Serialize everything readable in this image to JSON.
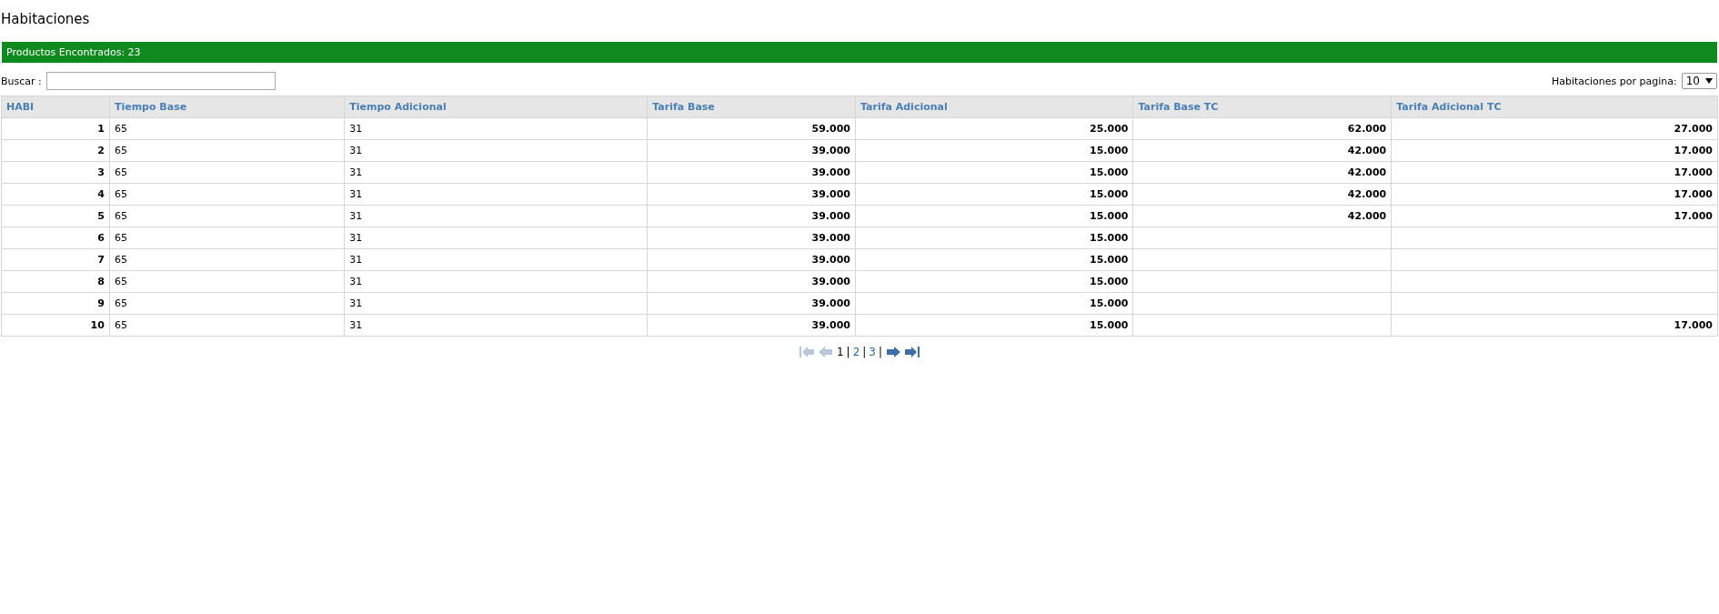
{
  "title": "Habitaciones",
  "banner": "Productos Encontrados: 23",
  "search": {
    "label": "Buscar :"
  },
  "per_page": {
    "label": "Habitaciones por pagina:",
    "value": "10"
  },
  "table": {
    "columns": [
      {
        "label": "HABI",
        "kind": "number"
      },
      {
        "label": "Tiempo Base",
        "kind": "text"
      },
      {
        "label": "Tiempo Adicional",
        "kind": "text"
      },
      {
        "label": "Tarifa Base",
        "kind": "number"
      },
      {
        "label": "Tarifa Adicional",
        "kind": "number"
      },
      {
        "label": "Tarifa Base TC",
        "kind": "number"
      },
      {
        "label": "Tarifa Adicional TC",
        "kind": "number"
      }
    ],
    "rows": [
      [
        "1",
        "65",
        "31",
        "59.000",
        "25.000",
        "62.000",
        "27.000"
      ],
      [
        "2",
        "65",
        "31",
        "39.000",
        "15.000",
        "42.000",
        "17.000"
      ],
      [
        "3",
        "65",
        "31",
        "39.000",
        "15.000",
        "42.000",
        "17.000"
      ],
      [
        "4",
        "65",
        "31",
        "39.000",
        "15.000",
        "42.000",
        "17.000"
      ],
      [
        "5",
        "65",
        "31",
        "39.000",
        "15.000",
        "42.000",
        "17.000"
      ],
      [
        "6",
        "65",
        "31",
        "39.000",
        "15.000",
        null,
        null
      ],
      [
        "7",
        "65",
        "31",
        "39.000",
        "15.000",
        null,
        null
      ],
      [
        "8",
        "65",
        "31",
        "39.000",
        "15.000",
        null,
        null
      ],
      [
        "9",
        "65",
        "31",
        "39.000",
        "15.000",
        null,
        null
      ],
      [
        "10",
        "65",
        "31",
        "39.000",
        "15.000",
        null,
        "17.000"
      ]
    ]
  },
  "pager": {
    "nav": [
      {
        "kind": "first",
        "disabled": true
      },
      {
        "kind": "prev",
        "disabled": true
      }
    ],
    "pages": [
      {
        "label": "1",
        "selected": true,
        "separator": "|"
      },
      {
        "label": "2",
        "selected": false,
        "separator": "|"
      },
      {
        "label": "3",
        "selected": false,
        "separator": "|"
      }
    ],
    "nav_after": [
      {
        "kind": "next",
        "disabled": false
      },
      {
        "kind": "last",
        "disabled": false
      }
    ]
  }
}
